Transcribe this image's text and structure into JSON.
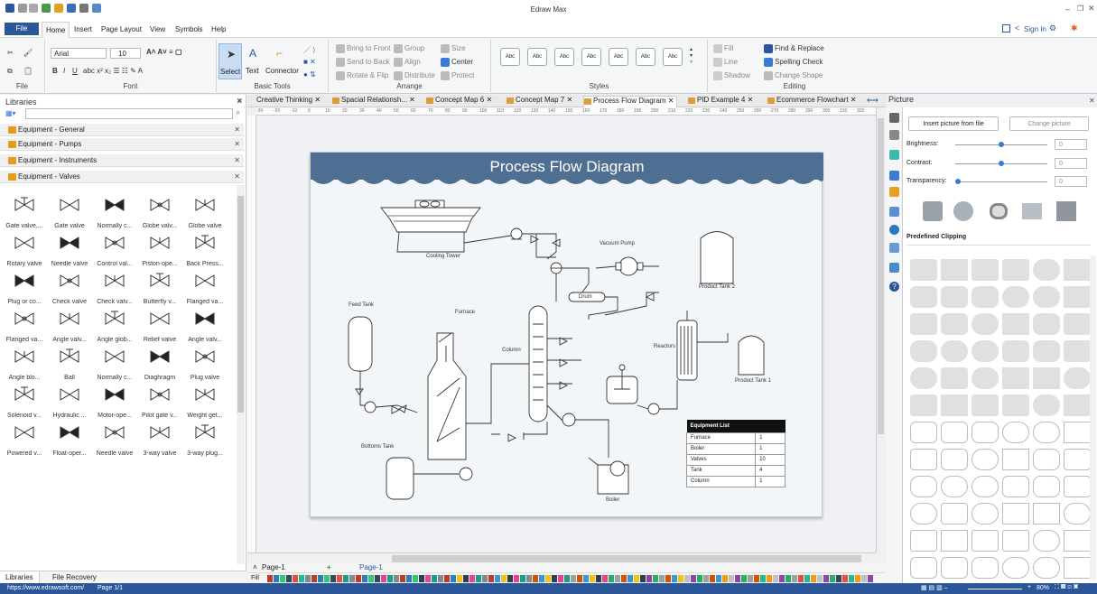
{
  "window": {
    "title": "Edraw Max"
  },
  "menu": {
    "file": "File",
    "items": [
      "Home",
      "Insert",
      "Page Layout",
      "View",
      "Symbols",
      "Help"
    ],
    "sign_in": "Sign In"
  },
  "ribbon": {
    "font_name": "Arial",
    "font_size": "10",
    "groups": {
      "file": "File",
      "font": "Font",
      "basic_tools": "Basic Tools",
      "arrange": "Arrange",
      "styles": "Styles",
      "editing": "Editing"
    },
    "tools": {
      "select": "Select",
      "text": "Text",
      "connector": "Connector"
    },
    "arrange": {
      "bring_front": "Bring to Front",
      "send_back": "Send to Back",
      "rotate_flip": "Rotate & Flip",
      "group": "Group",
      "align": "Align",
      "distribute": "Distribute",
      "size": "Size",
      "center": "Center",
      "protect": "Protect"
    },
    "style_samples": [
      "Abc",
      "Abc",
      "Abc",
      "Abc",
      "Abc",
      "Abc",
      "Abc"
    ],
    "fill_line": {
      "fill": "Fill",
      "line": "Line",
      "shadow": "Shadow"
    },
    "editing": {
      "find_replace": "Find & Replace",
      "spelling": "Spelling Check",
      "change_shape": "Change Shape"
    }
  },
  "libraries": {
    "title": "Libraries",
    "categories": [
      "Equipment - General",
      "Equipment - Pumps",
      "Equipment - Instruments",
      "Equipment - Valves"
    ],
    "shapes": [
      [
        "Gate valve,...",
        "Gate valve",
        "Normally c...",
        "Globe valv...",
        "Globe valve"
      ],
      [
        "Rotary valve",
        "Needle valve",
        "Control val...",
        "Piston-ope...",
        "Back Press..."
      ],
      [
        "Plug or co...",
        "Check valve",
        "Check valv...",
        "Butterfly v...",
        "Flanged va..."
      ],
      [
        "Flanged va...",
        "Angle valv...",
        "Angle glob...",
        "Relief valve",
        "Angle valv..."
      ],
      [
        "Angle blo...",
        "Ball",
        "Normally c...",
        "Diaghragm",
        "Plug valve"
      ],
      [
        "Solenoid v...",
        "Hydraulic ...",
        "Motor-ope...",
        "Pilot gate v...",
        "Weight get..."
      ],
      [
        "Powered v...",
        "Float-oper...",
        "Needle valve",
        "3-way valve",
        "3-way plug..."
      ]
    ],
    "tabs": [
      "Libraries",
      "File Recovery"
    ]
  },
  "doc_tabs": [
    {
      "label": "Creative Thinking",
      "active": false
    },
    {
      "label": "Spacial Relationsh...",
      "active": false
    },
    {
      "label": "Concept Map 6",
      "active": false
    },
    {
      "label": "Concept Map 7",
      "active": false
    },
    {
      "label": "Process Flow Diagram",
      "active": true
    },
    {
      "label": "PID Example 4",
      "active": false
    },
    {
      "label": "Ecommerce Flowchart",
      "active": false
    }
  ],
  "ruler_marks": [
    "-30",
    "-20",
    "-10",
    "0",
    "10",
    "20",
    "30",
    "40",
    "50",
    "60",
    "70",
    "80",
    "90",
    "100",
    "110",
    "120",
    "130",
    "140",
    "150",
    "160",
    "170",
    "180",
    "190",
    "200",
    "210",
    "220",
    "230",
    "240",
    "250",
    "260",
    "270",
    "280",
    "290",
    "300",
    "310",
    "320"
  ],
  "diagram": {
    "title": "Process Flow Diagram",
    "labels": {
      "cooling_tower": "Cooling Tower",
      "vacuum_pump": "Vacuum Pump",
      "drum": "Drum",
      "product_tank_2": "Product Tank 2",
      "feed_tank": "Feed Tank",
      "furnace": "Furnace",
      "column": "Column",
      "reactors": "Reactors",
      "product_tank_1": "Product Tank 1",
      "bottoms_tank": "Bottoms Tank",
      "boiler": "Boiler"
    },
    "equipment_list": {
      "title": "Equipment List",
      "rows": [
        [
          "Furnace",
          "1"
        ],
        [
          "Boiler",
          "1"
        ],
        [
          "Valves",
          "10"
        ],
        [
          "Tank",
          "4"
        ],
        [
          "Column",
          "1"
        ]
      ]
    }
  },
  "pages": {
    "current": "Page-1",
    "tab": "Page-1"
  },
  "fill_label": "Fill",
  "status": {
    "url": "https://www.edrawsoft.com/",
    "page": "Page 1/1",
    "zoom": "80%"
  },
  "picture_panel": {
    "title": "Picture",
    "insert_btn": "Insert picture from file",
    "change_btn": "Change picture",
    "brightness_label": "Brightness:",
    "brightness": "0",
    "brightness_level": 0.5,
    "contrast_label": "Contrast:",
    "contrast": "0",
    "contrast_level": 0.5,
    "transparency_label": "Transparency:",
    "transparency": "0",
    "transparency_level": 0,
    "clipping_title": "Predefined Clipping"
  },
  "colors": {
    "accent": "#2b579a",
    "header": "#4f6f92"
  }
}
